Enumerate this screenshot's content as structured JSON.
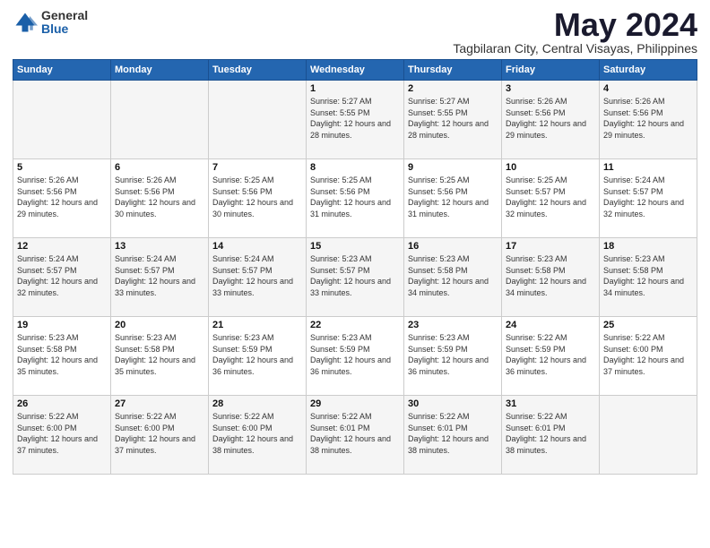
{
  "logo": {
    "general": "General",
    "blue": "Blue"
  },
  "title": "May 2024",
  "subtitle": "Tagbilaran City, Central Visayas, Philippines",
  "days_header": [
    "Sunday",
    "Monday",
    "Tuesday",
    "Wednesday",
    "Thursday",
    "Friday",
    "Saturday"
  ],
  "weeks": [
    [
      {
        "day": "",
        "info": ""
      },
      {
        "day": "",
        "info": ""
      },
      {
        "day": "",
        "info": ""
      },
      {
        "day": "1",
        "sunrise": "5:27 AM",
        "sunset": "5:55 PM",
        "daylight": "12 hours and 28 minutes."
      },
      {
        "day": "2",
        "sunrise": "5:27 AM",
        "sunset": "5:55 PM",
        "daylight": "12 hours and 28 minutes."
      },
      {
        "day": "3",
        "sunrise": "5:26 AM",
        "sunset": "5:56 PM",
        "daylight": "12 hours and 29 minutes."
      },
      {
        "day": "4",
        "sunrise": "5:26 AM",
        "sunset": "5:56 PM",
        "daylight": "12 hours and 29 minutes."
      }
    ],
    [
      {
        "day": "5",
        "sunrise": "5:26 AM",
        "sunset": "5:56 PM",
        "daylight": "12 hours and 29 minutes."
      },
      {
        "day": "6",
        "sunrise": "5:26 AM",
        "sunset": "5:56 PM",
        "daylight": "12 hours and 30 minutes."
      },
      {
        "day": "7",
        "sunrise": "5:25 AM",
        "sunset": "5:56 PM",
        "daylight": "12 hours and 30 minutes."
      },
      {
        "day": "8",
        "sunrise": "5:25 AM",
        "sunset": "5:56 PM",
        "daylight": "12 hours and 31 minutes."
      },
      {
        "day": "9",
        "sunrise": "5:25 AM",
        "sunset": "5:56 PM",
        "daylight": "12 hours and 31 minutes."
      },
      {
        "day": "10",
        "sunrise": "5:25 AM",
        "sunset": "5:57 PM",
        "daylight": "12 hours and 32 minutes."
      },
      {
        "day": "11",
        "sunrise": "5:24 AM",
        "sunset": "5:57 PM",
        "daylight": "12 hours and 32 minutes."
      }
    ],
    [
      {
        "day": "12",
        "sunrise": "5:24 AM",
        "sunset": "5:57 PM",
        "daylight": "12 hours and 32 minutes."
      },
      {
        "day": "13",
        "sunrise": "5:24 AM",
        "sunset": "5:57 PM",
        "daylight": "12 hours and 33 minutes."
      },
      {
        "day": "14",
        "sunrise": "5:24 AM",
        "sunset": "5:57 PM",
        "daylight": "12 hours and 33 minutes."
      },
      {
        "day": "15",
        "sunrise": "5:23 AM",
        "sunset": "5:57 PM",
        "daylight": "12 hours and 33 minutes."
      },
      {
        "day": "16",
        "sunrise": "5:23 AM",
        "sunset": "5:58 PM",
        "daylight": "12 hours and 34 minutes."
      },
      {
        "day": "17",
        "sunrise": "5:23 AM",
        "sunset": "5:58 PM",
        "daylight": "12 hours and 34 minutes."
      },
      {
        "day": "18",
        "sunrise": "5:23 AM",
        "sunset": "5:58 PM",
        "daylight": "12 hours and 34 minutes."
      }
    ],
    [
      {
        "day": "19",
        "sunrise": "5:23 AM",
        "sunset": "5:58 PM",
        "daylight": "12 hours and 35 minutes."
      },
      {
        "day": "20",
        "sunrise": "5:23 AM",
        "sunset": "5:58 PM",
        "daylight": "12 hours and 35 minutes."
      },
      {
        "day": "21",
        "sunrise": "5:23 AM",
        "sunset": "5:59 PM",
        "daylight": "12 hours and 36 minutes."
      },
      {
        "day": "22",
        "sunrise": "5:23 AM",
        "sunset": "5:59 PM",
        "daylight": "12 hours and 36 minutes."
      },
      {
        "day": "23",
        "sunrise": "5:23 AM",
        "sunset": "5:59 PM",
        "daylight": "12 hours and 36 minutes."
      },
      {
        "day": "24",
        "sunrise": "5:22 AM",
        "sunset": "5:59 PM",
        "daylight": "12 hours and 36 minutes."
      },
      {
        "day": "25",
        "sunrise": "5:22 AM",
        "sunset": "6:00 PM",
        "daylight": "12 hours and 37 minutes."
      }
    ],
    [
      {
        "day": "26",
        "sunrise": "5:22 AM",
        "sunset": "6:00 PM",
        "daylight": "12 hours and 37 minutes."
      },
      {
        "day": "27",
        "sunrise": "5:22 AM",
        "sunset": "6:00 PM",
        "daylight": "12 hours and 37 minutes."
      },
      {
        "day": "28",
        "sunrise": "5:22 AM",
        "sunset": "6:00 PM",
        "daylight": "12 hours and 38 minutes."
      },
      {
        "day": "29",
        "sunrise": "5:22 AM",
        "sunset": "6:01 PM",
        "daylight": "12 hours and 38 minutes."
      },
      {
        "day": "30",
        "sunrise": "5:22 AM",
        "sunset": "6:01 PM",
        "daylight": "12 hours and 38 minutes."
      },
      {
        "day": "31",
        "sunrise": "5:22 AM",
        "sunset": "6:01 PM",
        "daylight": "12 hours and 38 minutes."
      },
      {
        "day": "",
        "info": ""
      }
    ]
  ]
}
